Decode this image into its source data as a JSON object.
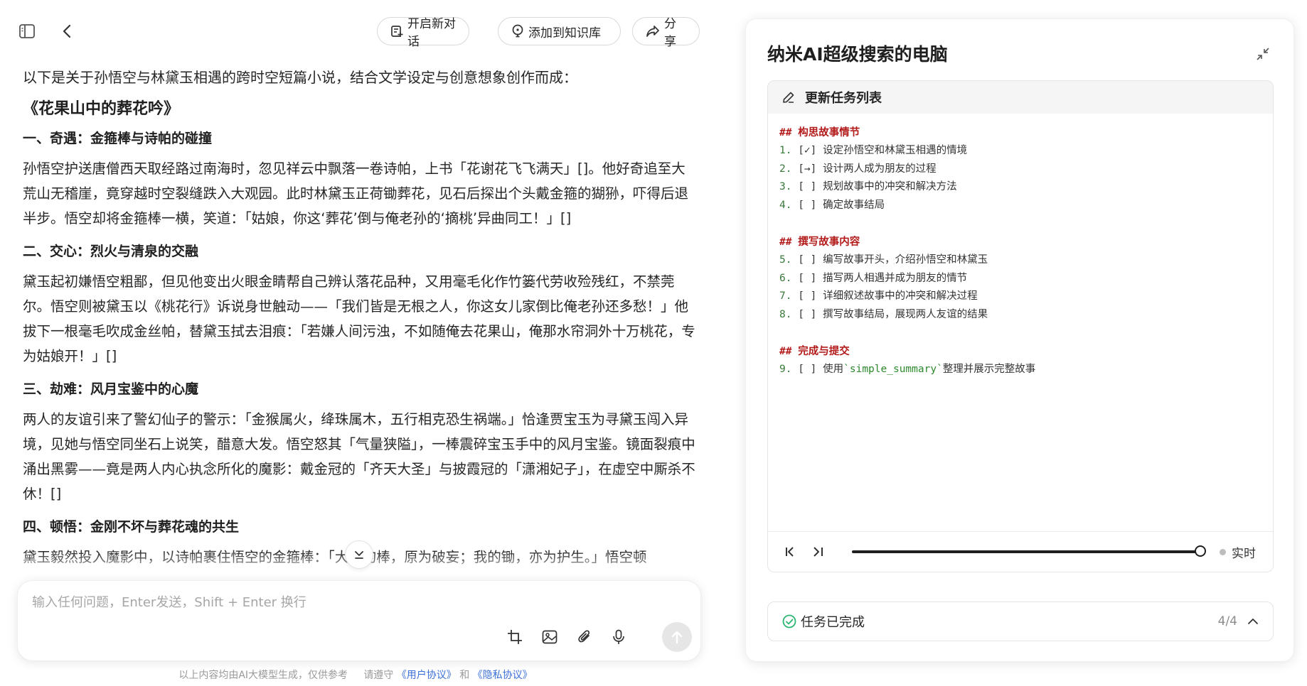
{
  "toolbar": {
    "new_chat_label": "开启新对话",
    "add_kb_label": "添加到知识库",
    "share_label": "分享"
  },
  "article": {
    "intro": "以下是关于孙悟空与林黛玉相遇的跨时空短篇小说，结合文学设定与创意想象创作而成：",
    "title": "《花果山中的葬花吟》",
    "sections": [
      {
        "heading": "一、奇遇：金箍棒与诗帕的碰撞",
        "body": "孙悟空护送唐僧西天取经路过南海时，忽见祥云中飘落一卷诗帕，上书「花谢花飞飞满天」[]。他好奇追至大荒山无稽崖，竟穿越时空裂缝跌入大观园。此时林黛玉正荷锄葬花，见石后探出个头戴金箍的猢狲，吓得后退半步。悟空却将金箍棒一横，笑道：「姑娘，你这‘葬花’倒与俺老孙的‘摘桃’异曲同工！」[]"
      },
      {
        "heading": "二、交心：烈火与清泉的交融",
        "body": "黛玉起初嫌悟空粗鄙，但见他变出火眼金睛帮自己辨认落花品种，又用毫毛化作竹篓代劳收殓残红，不禁莞尔。悟空则被黛玉以《桃花行》诉说身世触动——「我们皆是无根之人，你这女儿家倒比俺老孙还多愁！」他拔下一根毫毛吹成金丝帕，替黛玉拭去泪痕：「若嫌人间污浊，不如随俺去花果山，俺那水帘洞外十万桃花，专为姑娘开！」[]"
      },
      {
        "heading": "三、劫难：风月宝鉴中的心魔",
        "body": "两人的友谊引来了警幻仙子的警示：「金猴属火，绛珠属木，五行相克恐生祸端。」恰逢贾宝玉为寻黛玉闯入异境，见她与悟空同坐石上说笑，醋意大发。悟空怒其「气量狭隘」，一棒震碎宝玉手中的风月宝鉴。镜面裂痕中涌出黑雾——竟是两人内心执念所化的魔影：戴金冠的「齐天大圣」与披霞冠的「潇湘妃子」，在虚空中厮杀不休！[]"
      },
      {
        "heading": "四、顿悟：金刚不坏与葬花魂的共生",
        "body": "黛玉毅然投入魔影中，以诗帕裹住悟空的金箍棒：「大圣的棒，原为破妄；我的锄，亦为护生。」悟空顿"
      }
    ]
  },
  "input": {
    "placeholder": "输入任何问题，Enter发送，Shift + Enter 换行"
  },
  "footer": {
    "prefix": "以上内容均由AI大模型生成，仅供参考",
    "mid": "请遵守",
    "link1": "《用户协议》",
    "and": "和",
    "link2": "《隐私协议》"
  },
  "panel": {
    "title": "纳米AI超级搜索的电脑",
    "terminal_title": "更新任务列表",
    "sections": [
      {
        "heading": "## 构思故事情节",
        "items": [
          {
            "num": "1.",
            "text": "[✓] 设定孙悟空和林黛玉相遇的情境"
          },
          {
            "num": "2.",
            "text": "[→] 设计两人成为朋友的过程"
          },
          {
            "num": "3.",
            "text": "[ ] 规划故事中的冲突和解决方法"
          },
          {
            "num": "4.",
            "text": "[ ] 确定故事结局"
          }
        ]
      },
      {
        "heading": "## 撰写故事内容",
        "items": [
          {
            "num": "5.",
            "text": "[ ] 编写故事开头，介绍孙悟空和林黛玉"
          },
          {
            "num": "6.",
            "text": "[ ] 描写两人相遇并成为朋友的情节"
          },
          {
            "num": "7.",
            "text": "[ ] 详细叙述故事中的冲突和解决过程"
          },
          {
            "num": "8.",
            "text": "[ ] 撰写故事结局，展现两人友谊的结果"
          }
        ]
      },
      {
        "heading": "## 完成与提交",
        "items": [
          {
            "num": "9.",
            "text": "[ ] 使用`simple_summary`整理并展示完整故事"
          }
        ]
      }
    ],
    "live_label": "实时",
    "playback_progress": 1.0,
    "status_label": "任务已完成",
    "status_count": "4/4"
  },
  "colors": {
    "accent_green": "#2bb673",
    "heading_red": "#b31b1b",
    "link_blue": "#3b6fd6"
  },
  "icons": [
    "sidebar-toggle-icon",
    "back-arrow-icon",
    "new-chat-icon",
    "bulb-icon",
    "share-icon",
    "chevron-down-icon",
    "crop-icon",
    "image-icon",
    "paperclip-icon",
    "microphone-icon",
    "send-arrow-icon",
    "collapse-icon",
    "pencil-icon",
    "skip-back-icon",
    "step-forward-icon",
    "check-circle-icon",
    "chevron-up-icon"
  ]
}
